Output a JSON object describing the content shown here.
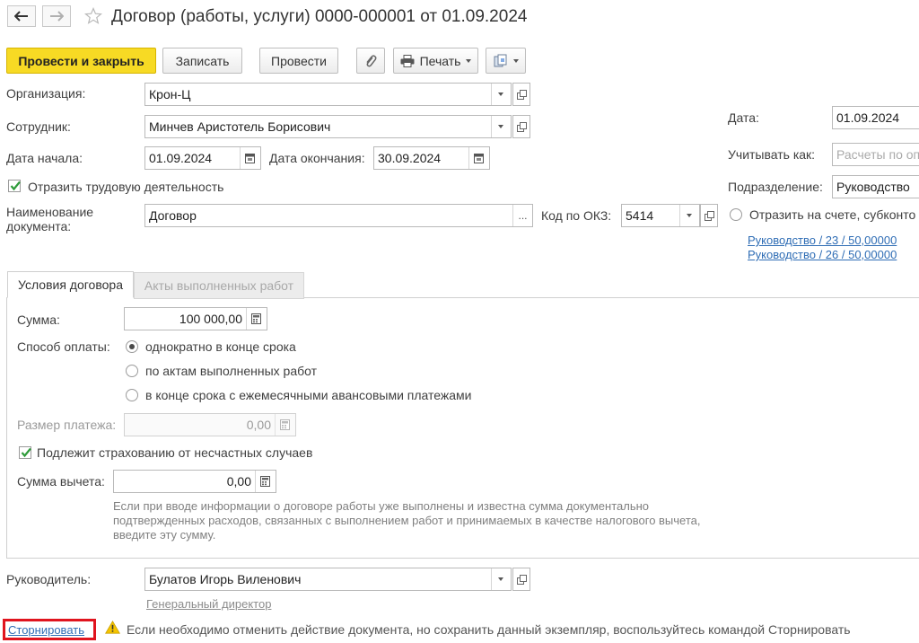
{
  "window": {
    "title": "Договор (работы, услуги) 0000-000001 от 01.09.2024"
  },
  "toolbar": {
    "post_close": "Провести и закрыть",
    "save": "Записать",
    "post": "Провести",
    "print": "Печать"
  },
  "form": {
    "org_label": "Организация:",
    "org_value": "Крон-Ц",
    "emp_label": "Сотрудник:",
    "emp_value": "Минчев Аристотель Борисович",
    "start_label": "Дата начала:",
    "start_value": "01.09.2024",
    "end_label": "Дата окончания:",
    "end_value": "30.09.2024",
    "labor_check_label": "Отразить трудовую деятельность",
    "labor_checked": true,
    "docname_label_1": "Наименование",
    "docname_label_2": "документа:",
    "docname_value": "Договор",
    "okz_label": "Код по ОКЗ:",
    "okz_value": "5414"
  },
  "right": {
    "date_label": "Дата:",
    "date_value": "01.09.2024",
    "account_as_label": "Учитывать как:",
    "account_as_placeholder": "Расчеты по оп",
    "dept_label": "Подразделение:",
    "dept_value": "Руководство",
    "reflect_label": "Отразить на счете, субконто",
    "link1": "Руководство / 23 / 50,00000",
    "link2": "Руководство / 26 / 50,00000"
  },
  "tabs": [
    {
      "label": "Условия договора",
      "active": true
    },
    {
      "label": "Акты выполненных работ",
      "active": false
    }
  ],
  "conditions": {
    "sum_label": "Сумма:",
    "sum_value": "100 000,00",
    "pay_label": "Способ оплаты:",
    "pay_options": [
      "однократно в конце срока",
      "по актам выполненных работ",
      "в конце срока с ежемесячными авансовыми платежами"
    ],
    "pay_selected": 0,
    "payment_size_label": "Размер платежа:",
    "payment_size_value": "0,00",
    "insurance_label": "Подлежит страхованию от несчастных случаев",
    "insurance_checked": true,
    "deduction_label": "Сумма вычета:",
    "deduction_value": "0,00",
    "hint_lines": [
      "Если при вводе информации о договоре работы уже выполнены и известна сумма документально",
      "подтвержденных расходов, связанных с выполнением работ и принимаемых в качестве налогового вычета,",
      "введите эту сумму."
    ]
  },
  "footer": {
    "head_label": "Руководитель:",
    "head_value": "Булатов Игорь Виленович",
    "head_position": "Генеральный директор",
    "storno_link": "Сторнировать",
    "warning_text": "Если необходимо отменить действие документа, но сохранить данный экземпляр, воспользуйтесь командой Сторнировать"
  }
}
